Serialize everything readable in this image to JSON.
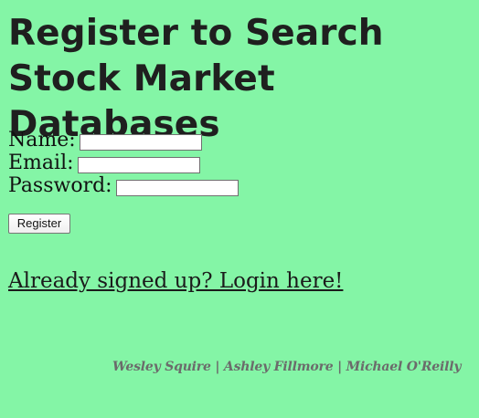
{
  "page": {
    "title": "Register to Search Stock Market Databases"
  },
  "form": {
    "name_label": "Name:",
    "email_label": "Email:",
    "password_label": "Password:",
    "name_value": "",
    "email_value": "",
    "password_value": "",
    "register_label": "Register"
  },
  "links": {
    "login_text": "Already signed up? Login here!"
  },
  "footer": {
    "authors": "Wesley Squire | Ashley Fillmore | Michael O'Reilly"
  },
  "colors": {
    "background": "#84f5a6",
    "title_text": "#1f1f1f",
    "footer_text": "#6b6b6b"
  }
}
